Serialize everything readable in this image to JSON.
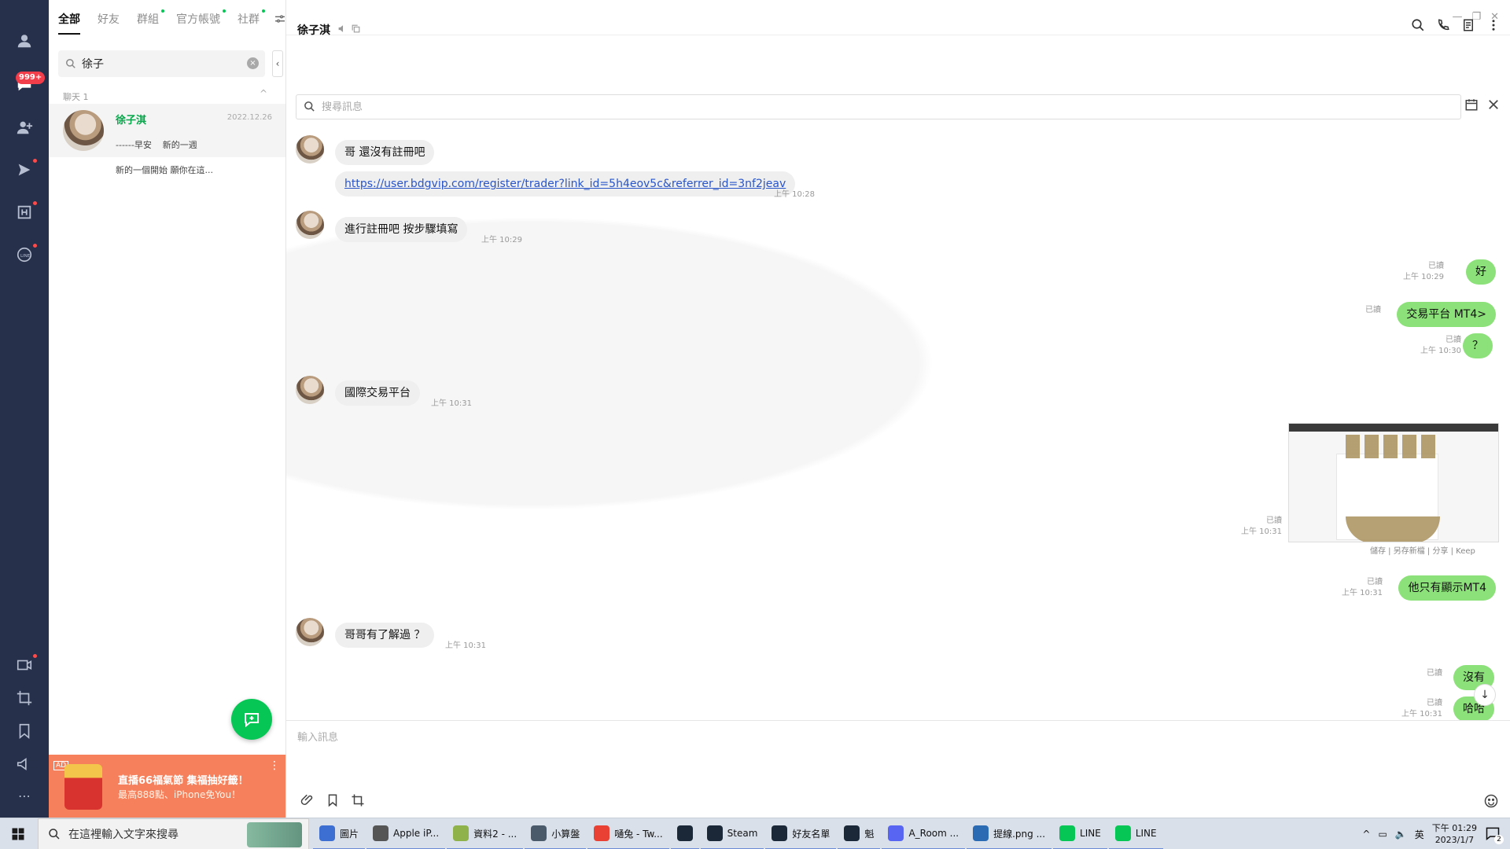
{
  "colors": {
    "rail": "#26304a",
    "accent_green": "#06c755",
    "bubble_out": "#8de17a",
    "bubble_in": "#efefef",
    "badge": "#f23d4a",
    "ad": "#f5805b"
  },
  "rail": {
    "badge": "999+"
  },
  "list": {
    "tabs": [
      {
        "label": "全部",
        "active": true
      },
      {
        "label": "好友"
      },
      {
        "label": "群組"
      },
      {
        "label": "官方帳號"
      },
      {
        "label": "社群"
      }
    ],
    "search_value": "徐子",
    "section_label": "聊天 1",
    "chat_item": {
      "name": "徐子淇",
      "date": "2022.12.26",
      "preview_line1": "------早安    新的一週",
      "preview_line2": "新的一個開始 願你在這..."
    }
  },
  "ad": {
    "tag": "AD",
    "title": "直播66福氣節 集福抽好籤！",
    "subtitle": "最高888點、iPhone免You！"
  },
  "chat": {
    "title": "徐子淇",
    "search_placeholder": "搜尋訊息",
    "composer_placeholder": "輸入訊息",
    "messages": {
      "m1": {
        "text": "哥 還沒有註冊吧"
      },
      "m2": {
        "text": "https://user.bdgvip.com/register/trader?link_id=5h4eov5c&referrer_id=3nf2jeav",
        "time": "上午 10:28"
      },
      "m3": {
        "text": "進行註冊吧 按步驟填寫",
        "time": "上午 10:29"
      },
      "o1": {
        "text": "好",
        "read": "已讀",
        "time": "上午 10:29"
      },
      "o2": {
        "text": "交易平台 MT4>",
        "read": "已讀"
      },
      "o3": {
        "text": "？",
        "read": "已讀",
        "time": "上午 10:30"
      },
      "m4": {
        "text": "國際交易平台",
        "time": "上午 10:31"
      },
      "img": {
        "read": "已讀",
        "time": "上午 10:31",
        "actions": "儲存 | 另存新檔 | 分享 | Keep"
      },
      "o4": {
        "text": "他只有顯示MT4",
        "read": "已讀",
        "time": "上午 10:31"
      },
      "m5": {
        "text": "哥哥有了解過 ？",
        "time": "上午 10:31"
      },
      "o5": {
        "text": "沒有",
        "read": "已讀"
      },
      "o6": {
        "text": "哈哈",
        "read": "已讀",
        "time": "上午 10:31"
      }
    }
  },
  "taskbar": {
    "search_placeholder": "在這裡輸入文字來搜尋",
    "apps": [
      {
        "label": "圖片",
        "color": "#3c6fd1"
      },
      {
        "label": "Apple iP...",
        "color": "#555"
      },
      {
        "label": "資料2 - ...",
        "color": "#8fb34a"
      },
      {
        "label": "小算盤",
        "color": "#4b5a6b"
      },
      {
        "label": "嗵兔 - Tw...",
        "color": "#e94235"
      },
      {
        "label": "",
        "color": "#1b2838"
      },
      {
        "label": "Steam",
        "color": "#1b2838"
      },
      {
        "label": "好友名單",
        "color": "#1b2838"
      },
      {
        "label": "魁",
        "color": "#1b2838"
      },
      {
        "label": "A_Room ...",
        "color": "#5865f2"
      },
      {
        "label": "提線.png ...",
        "color": "#2b6bb3"
      },
      {
        "label": "LINE",
        "color": "#06c755"
      },
      {
        "label": "LINE",
        "color": "#06c755"
      }
    ],
    "ime": "英",
    "time": "下午 01:29",
    "date": "2023/1/7",
    "notifications": "2"
  }
}
